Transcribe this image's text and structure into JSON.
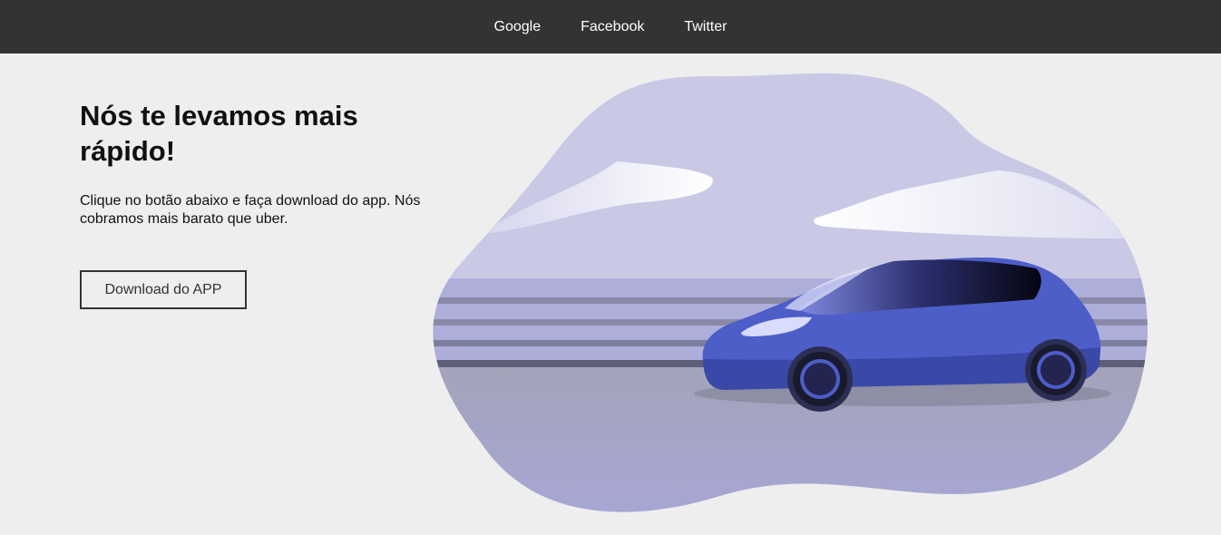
{
  "nav": {
    "links": [
      "Google",
      "Facebook",
      "Twitter"
    ]
  },
  "hero": {
    "title": "Nós te levamos mais rápido!",
    "description": "Clique no botão abaixo e faça download do app. Nós cobramos mais barato que uber.",
    "button_label": "Download do APP"
  },
  "illustration": {
    "icon": "car-on-road-illustration"
  },
  "colors": {
    "navbar": "#333333",
    "background": "#eeeeee",
    "sky": "#c9c9e6",
    "car": "#4d5ec9",
    "road": "#9d9db8"
  }
}
